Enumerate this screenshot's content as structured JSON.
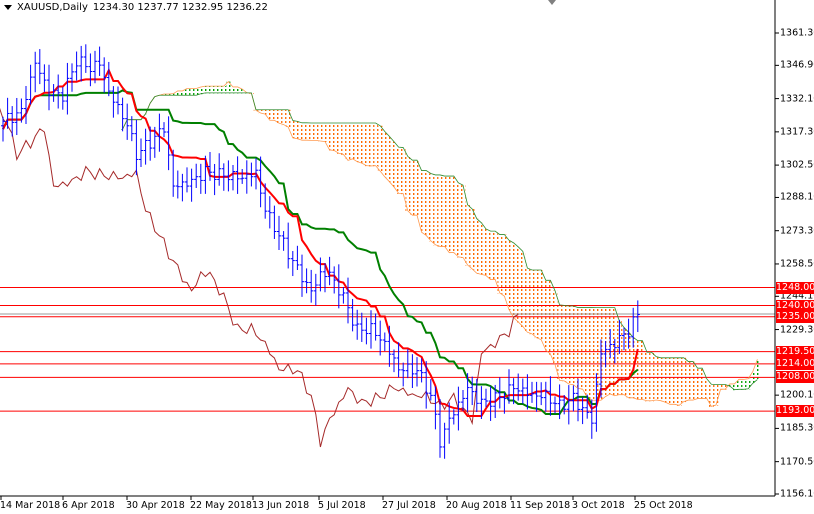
{
  "header": {
    "symbol": "XAUUSD,Daily",
    "ohlc": "1234.30 1237.77 1232.95 1236.22"
  },
  "colors": {
    "bar": "#0000ff",
    "tenkan": "#ff0000",
    "kijun": "#008000",
    "chikou": "#a52a2a",
    "cloud_bear": "#ff6a00",
    "cloud_bull": "#00a000",
    "level": "#ff0000"
  },
  "chart_data": {
    "type": "candlestick-ichimoku",
    "title": "XAUUSD,Daily",
    "ylim": [
      1156.1,
      1361.3
    ],
    "y_ticks": [
      "1361.30",
      "1346.90",
      "1332.10",
      "1317.30",
      "1302.50",
      "1288.10",
      "1273.30",
      "1258.50",
      "1244.10",
      "1229.30",
      "1200.10",
      "1185.30",
      "1170.50",
      "1156.10"
    ],
    "x_ticks": [
      "14 Mar 2018",
      "6 Apr 2018",
      "30 Apr 2018",
      "22 May 2018",
      "13 Jun 2018",
      "5 Jul 2018",
      "27 Jul 2018",
      "20 Aug 2018",
      "11 Sep 2018",
      "3 Oct 2018",
      "25 Oct 2018"
    ],
    "levels": [
      "1248.00",
      "1240.00",
      "1235.00",
      "1219.50",
      "1214.00",
      "1208.00",
      "1193.00"
    ],
    "current_price": 1236.22,
    "close_anchors": [
      [
        0,
        1322
      ],
      [
        4,
        1327
      ],
      [
        7,
        1349
      ],
      [
        10,
        1336
      ],
      [
        13,
        1334
      ],
      [
        16,
        1349
      ],
      [
        19,
        1345
      ],
      [
        21,
        1347
      ],
      [
        23,
        1334
      ],
      [
        27,
        1320
      ],
      [
        29,
        1307
      ],
      [
        32,
        1313
      ],
      [
        35,
        1320
      ],
      [
        37,
        1294
      ],
      [
        41,
        1296
      ],
      [
        44,
        1300
      ],
      [
        47,
        1298
      ],
      [
        52,
        1296
      ],
      [
        55,
        1298
      ],
      [
        57,
        1282
      ],
      [
        60,
        1271
      ],
      [
        63,
        1260
      ],
      [
        67,
        1247
      ],
      [
        69,
        1255
      ],
      [
        71,
        1255
      ],
      [
        74,
        1244
      ],
      [
        77,
        1229
      ],
      [
        80,
        1229
      ],
      [
        83,
        1222
      ],
      [
        86,
        1211
      ],
      [
        90,
        1211
      ],
      [
        93,
        1200
      ],
      [
        95,
        1180
      ],
      [
        97,
        1190
      ],
      [
        99,
        1197
      ],
      [
        101,
        1204
      ],
      [
        104,
        1197
      ],
      [
        108,
        1199
      ],
      [
        111,
        1203
      ],
      [
        115,
        1199
      ],
      [
        118,
        1199
      ],
      [
        121,
        1195
      ],
      [
        124,
        1199
      ],
      [
        128,
        1190
      ],
      [
        130,
        1220
      ],
      [
        133,
        1224
      ],
      [
        136,
        1229
      ],
      [
        138,
        1236
      ]
    ]
  }
}
